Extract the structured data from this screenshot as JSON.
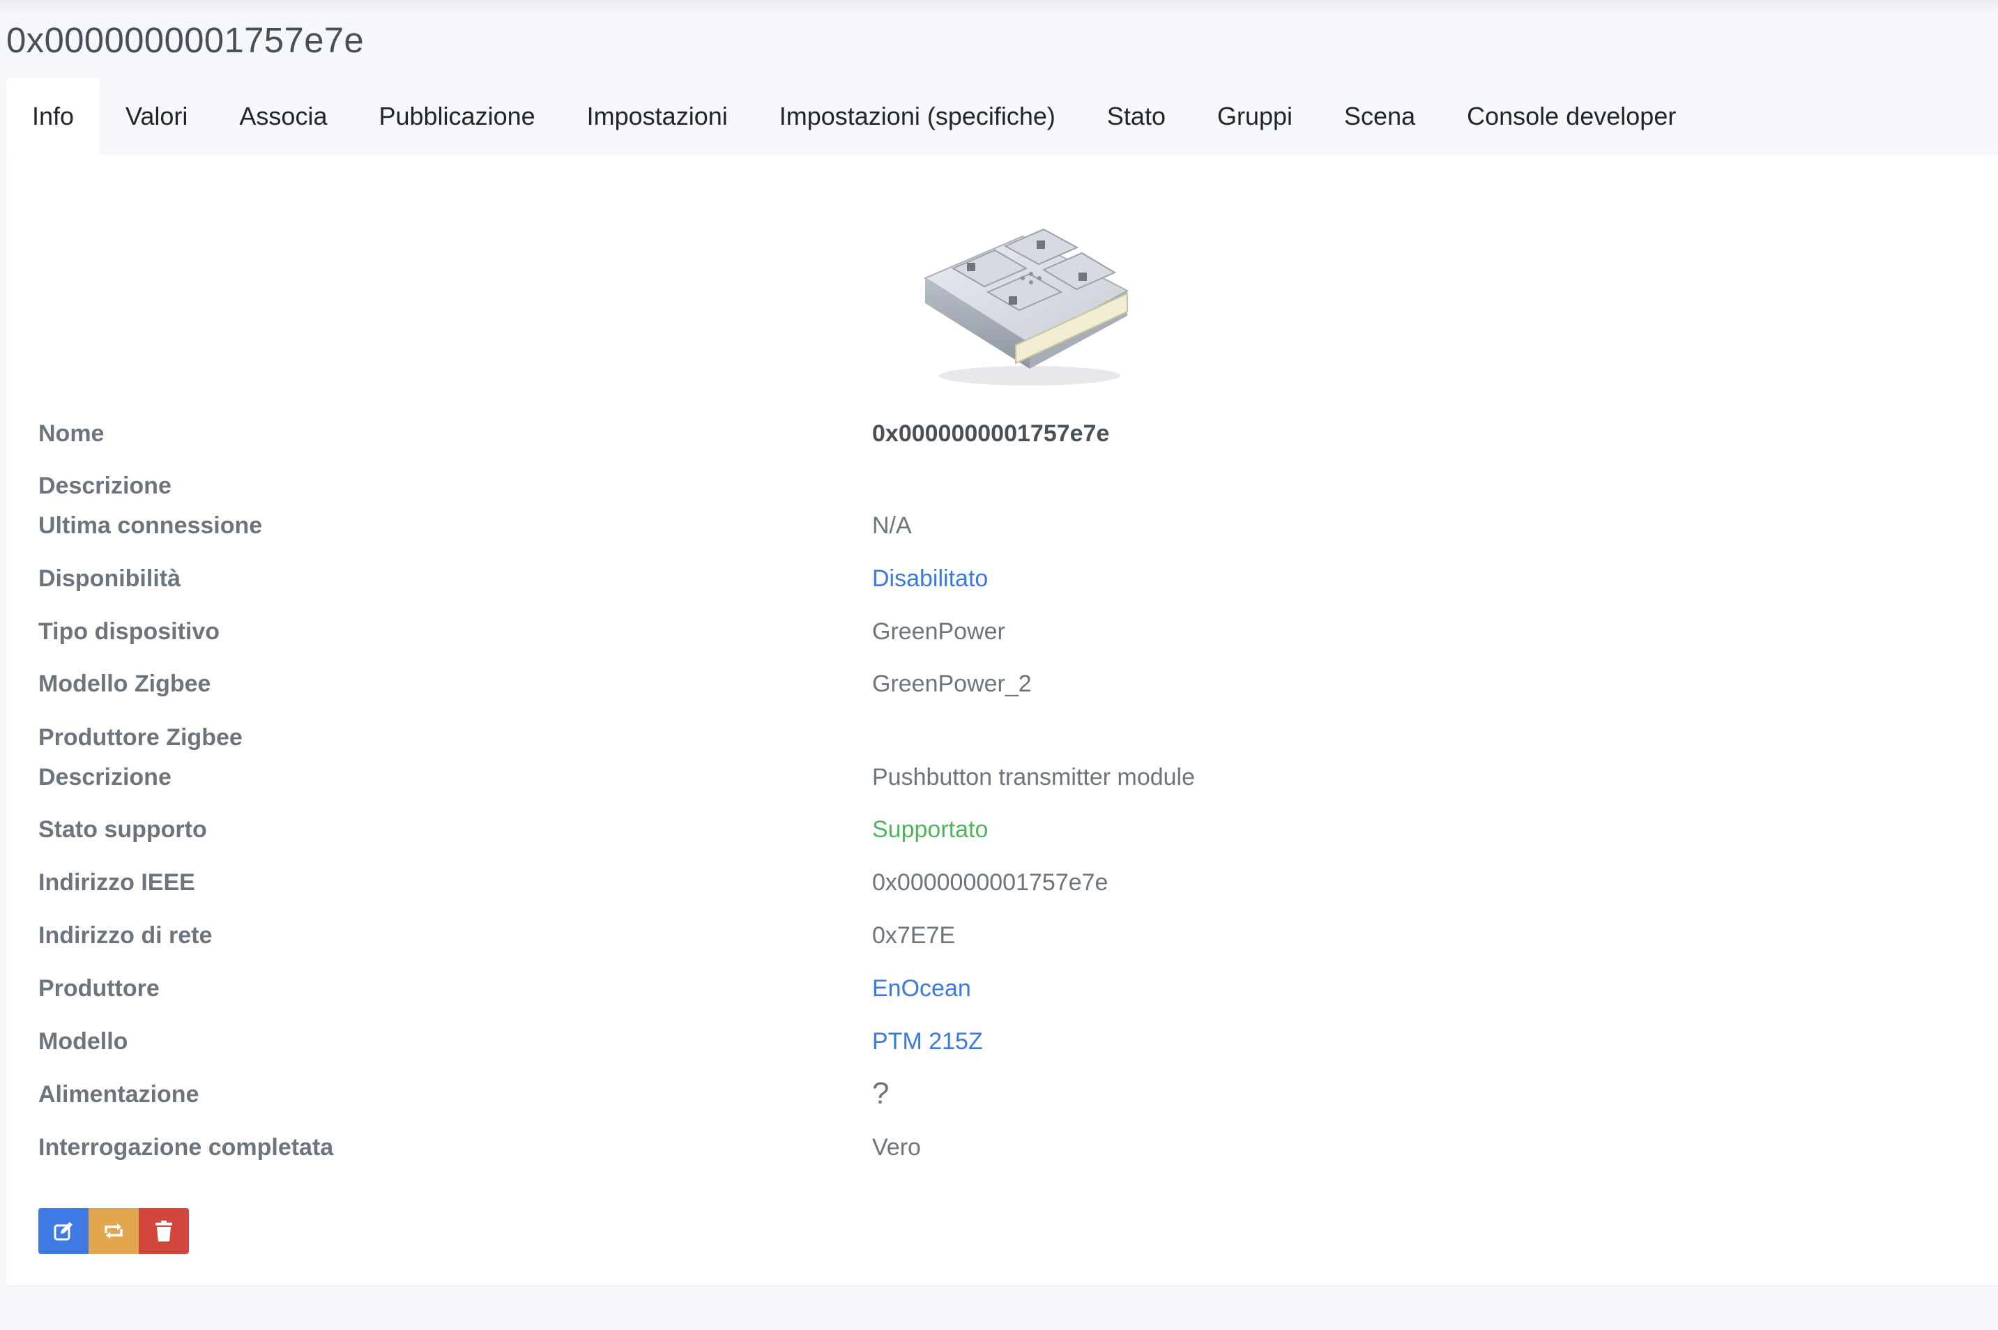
{
  "page": {
    "title": "0x0000000001757e7e"
  },
  "tabs": [
    {
      "label": "Info",
      "active": true
    },
    {
      "label": "Valori"
    },
    {
      "label": "Associa"
    },
    {
      "label": "Pubblicazione"
    },
    {
      "label": "Impostazioni"
    },
    {
      "label": "Impostazioni (specifiche)"
    },
    {
      "label": "Stato"
    },
    {
      "label": "Gruppi"
    },
    {
      "label": "Scena"
    },
    {
      "label": "Console developer"
    }
  ],
  "info": {
    "rows": [
      {
        "label": "Nome",
        "value": "0x0000000001757e7e"
      },
      {
        "label": "Descrizione",
        "value": ""
      },
      {
        "label": "Ultima connessione",
        "value": "N/A"
      },
      {
        "label": "Disponibilità",
        "value": "Disabilitato"
      },
      {
        "label": "Tipo dispositivo",
        "value": "GreenPower"
      },
      {
        "label": "Modello Zigbee",
        "value": "GreenPower_2"
      },
      {
        "label": "Produttore Zigbee",
        "value": ""
      },
      {
        "label": "Descrizione",
        "value": "Pushbutton transmitter module"
      },
      {
        "label": "Stato supporto",
        "value": "Supportato"
      },
      {
        "label": "Indirizzo IEEE",
        "value": "0x0000000001757e7e"
      },
      {
        "label": "Indirizzo di rete",
        "value": "0x7E7E"
      },
      {
        "label": "Produttore",
        "value": "EnOcean"
      },
      {
        "label": "Modello",
        "value": "PTM 215Z"
      },
      {
        "label": "Alimentazione",
        "value": "?"
      },
      {
        "label": "Interrogazione completata",
        "value": "Vero"
      }
    ]
  },
  "actions": [
    {
      "name": "edit",
      "icon": "edit-icon",
      "color": "#3f79e4"
    },
    {
      "name": "reconfigure",
      "icon": "reconfigure-icon",
      "color": "#e2a64e"
    },
    {
      "name": "delete",
      "icon": "trash-icon",
      "color": "#d3463d"
    }
  ],
  "colors": {
    "link": "#3a7ae0",
    "supported": "#4fb55c",
    "label": "#6c757d"
  }
}
